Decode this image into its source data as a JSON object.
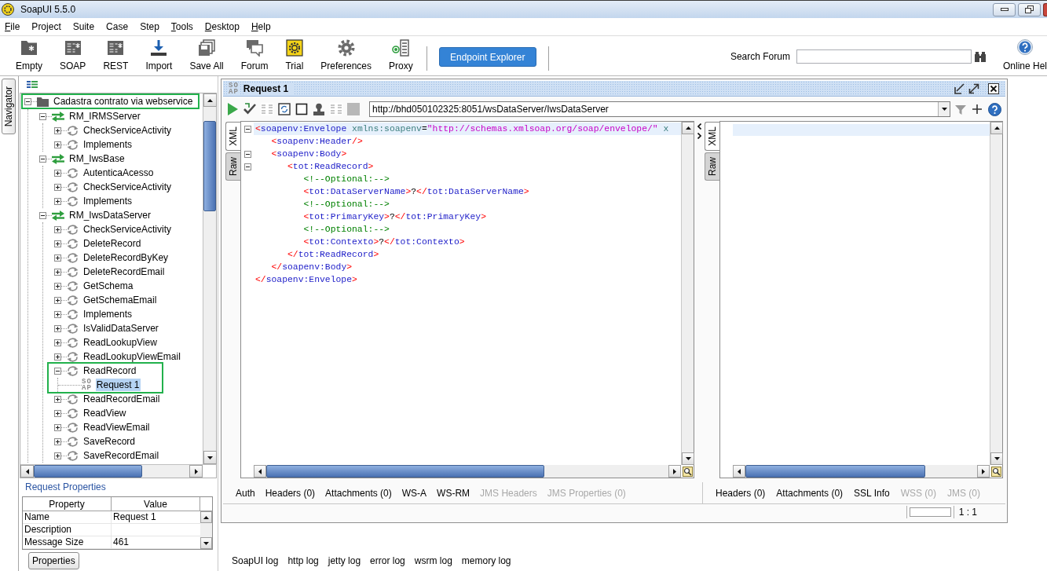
{
  "window": {
    "title": "SoapUI 5.5.0"
  },
  "menu": [
    {
      "label": "File",
      "mnemonic": true
    },
    {
      "label": "Project",
      "mnemonic": false
    },
    {
      "label": "Suite",
      "mnemonic": false
    },
    {
      "label": "Case",
      "mnemonic": false
    },
    {
      "label": "Step",
      "mnemonic": false
    },
    {
      "label": "Tools",
      "mnemonic": true
    },
    {
      "label": "Desktop",
      "mnemonic": true
    },
    {
      "label": "Help",
      "mnemonic": true
    }
  ],
  "toolbar": {
    "buttons": [
      {
        "label": "Empty"
      },
      {
        "label": "SOAP"
      },
      {
        "label": "REST"
      },
      {
        "label": "Import"
      },
      {
        "label": "Save All"
      },
      {
        "label": "Forum"
      },
      {
        "label": "Trial"
      },
      {
        "label": "Preferences"
      },
      {
        "label": "Proxy"
      }
    ],
    "endpoint_explorer": "Endpoint Explorer",
    "search_label": "Search Forum",
    "help_label": "Online Hel"
  },
  "navigator": {
    "tab": "Navigator",
    "tree": [
      {
        "label": "Cadastra contrato via webservice",
        "kind": "project",
        "expanded": true,
        "selected": false,
        "framed": true,
        "frame_children": false,
        "children": [
          {
            "label": "RM_IRMSServer",
            "kind": "interface",
            "expanded": true,
            "selected": false,
            "children": [
              {
                "label": "CheckServiceActivity",
                "kind": "operation",
                "expanded": false,
                "selected": false
              },
              {
                "label": "Implements",
                "kind": "operation",
                "expanded": false,
                "selected": false
              }
            ]
          },
          {
            "label": "RM_IwsBase",
            "kind": "interface",
            "expanded": true,
            "selected": false,
            "children": [
              {
                "label": "AutenticaAcesso",
                "kind": "operation",
                "expanded": false,
                "selected": false
              },
              {
                "label": "CheckServiceActivity",
                "kind": "operation",
                "expanded": false,
                "selected": false
              },
              {
                "label": "Implements",
                "kind": "operation",
                "expanded": false,
                "selected": false
              }
            ]
          },
          {
            "label": "RM_IwsDataServer",
            "kind": "interface",
            "expanded": true,
            "selected": false,
            "children": [
              {
                "label": "CheckServiceActivity",
                "kind": "operation",
                "expanded": false,
                "selected": false
              },
              {
                "label": "DeleteRecord",
                "kind": "operation",
                "expanded": false,
                "selected": false
              },
              {
                "label": "DeleteRecordByKey",
                "kind": "operation",
                "expanded": false,
                "selected": false
              },
              {
                "label": "DeleteRecordEmail",
                "kind": "operation",
                "expanded": false,
                "selected": false
              },
              {
                "label": "GetSchema",
                "kind": "operation",
                "expanded": false,
                "selected": false
              },
              {
                "label": "GetSchemaEmail",
                "kind": "operation",
                "expanded": false,
                "selected": false
              },
              {
                "label": "Implements",
                "kind": "operation",
                "expanded": false,
                "selected": false
              },
              {
                "label": "IsValidDataServer",
                "kind": "operation",
                "expanded": false,
                "selected": false
              },
              {
                "label": "ReadLookupView",
                "kind": "operation",
                "expanded": false,
                "selected": false
              },
              {
                "label": "ReadLookupViewEmail",
                "kind": "operation",
                "expanded": false,
                "selected": false
              },
              {
                "label": "ReadRecord",
                "kind": "operation",
                "expanded": true,
                "selected": false,
                "framed": true,
                "frame_children": true,
                "children": [
                  {
                    "label": "Request 1",
                    "kind": "request",
                    "badge": [
                      "SO",
                      "AP"
                    ],
                    "selected": true
                  }
                ]
              },
              {
                "label": "ReadRecordEmail",
                "kind": "operation",
                "expanded": false,
                "selected": false
              },
              {
                "label": "ReadView",
                "kind": "operation",
                "expanded": false,
                "selected": false
              },
              {
                "label": "ReadViewEmail",
                "kind": "operation",
                "expanded": false,
                "selected": false
              },
              {
                "label": "SaveRecord",
                "kind": "operation",
                "expanded": false,
                "selected": false
              },
              {
                "label": "SaveRecordEmail",
                "kind": "operation",
                "expanded": false,
                "selected": false
              }
            ]
          }
        ]
      }
    ],
    "properties": {
      "title": "Request Properties",
      "columns": [
        "Property",
        "Value"
      ],
      "rows": [
        {
          "property": "Name",
          "value": "Request 1"
        },
        {
          "property": "Description"
        },
        {
          "property": "Message Size",
          "value": "461"
        }
      ]
    },
    "button": "Properties"
  },
  "editor": {
    "title": "Request 1",
    "badge": [
      "SO",
      "AP"
    ],
    "endpoint": "http://bhd050102325:8051/wsDataServer/IwsDataServer",
    "request": {
      "tabs": [
        {
          "label": "XML",
          "selected": true
        },
        {
          "label": "Raw",
          "selected": false
        }
      ],
      "lines": [
        {
          "fold": true,
          "current": true,
          "tokens": [
            {
              "kind": "bracket",
              "text": "<"
            },
            {
              "kind": "tag",
              "text": "soapenv:Envelope"
            },
            {
              "kind": "attribute",
              "text": " xmlns:soapenv"
            },
            {
              "kind": "equals",
              "text": "="
            },
            {
              "kind": "string",
              "text": "\"http://schemas.xmlsoap.org/soap/envelope/\""
            },
            {
              "kind": "attribute",
              "text": " x"
            }
          ]
        },
        {
          "fold": false,
          "current": false,
          "tokens": [
            {
              "kind": "bracket",
              "text": "   <"
            },
            {
              "kind": "tag",
              "text": "soapenv:Header"
            },
            {
              "kind": "bracket",
              "text": "/>"
            }
          ]
        },
        {
          "fold": true,
          "current": false,
          "tokens": [
            {
              "kind": "bracket",
              "text": "   <"
            },
            {
              "kind": "tag",
              "text": "soapenv:Body"
            },
            {
              "kind": "bracket",
              "text": ">"
            }
          ]
        },
        {
          "fold": true,
          "current": false,
          "tokens": [
            {
              "kind": "bracket",
              "text": "      <"
            },
            {
              "kind": "tag",
              "text": "tot:ReadRecord"
            },
            {
              "kind": "bracket",
              "text": ">"
            }
          ]
        },
        {
          "fold": false,
          "current": false,
          "tokens": [
            {
              "kind": "comment",
              "text": "         <!--Optional:-->"
            }
          ]
        },
        {
          "fold": false,
          "current": false,
          "tokens": [
            {
              "kind": "bracket",
              "text": "         <"
            },
            {
              "kind": "tag",
              "text": "tot:DataServerName"
            },
            {
              "kind": "bracket",
              "text": ">"
            },
            {
              "kind": "text",
              "text": "?"
            },
            {
              "kind": "bracket",
              "text": "</"
            },
            {
              "kind": "tag",
              "text": "tot:DataServerName"
            },
            {
              "kind": "bracket",
              "text": ">"
            }
          ]
        },
        {
          "fold": false,
          "current": false,
          "tokens": [
            {
              "kind": "comment",
              "text": "         <!--Optional:-->"
            }
          ]
        },
        {
          "fold": false,
          "current": false,
          "tokens": [
            {
              "kind": "bracket",
              "text": "         <"
            },
            {
              "kind": "tag",
              "text": "tot:PrimaryKey"
            },
            {
              "kind": "bracket",
              "text": ">"
            },
            {
              "kind": "text",
              "text": "?"
            },
            {
              "kind": "bracket",
              "text": "</"
            },
            {
              "kind": "tag",
              "text": "tot:PrimaryKey"
            },
            {
              "kind": "bracket",
              "text": ">"
            }
          ]
        },
        {
          "fold": false,
          "current": false,
          "tokens": [
            {
              "kind": "comment",
              "text": "         <!--Optional:-->"
            }
          ]
        },
        {
          "fold": false,
          "current": false,
          "tokens": [
            {
              "kind": "bracket",
              "text": "         <"
            },
            {
              "kind": "tag",
              "text": "tot:Contexto"
            },
            {
              "kind": "bracket",
              "text": ">"
            },
            {
              "kind": "text",
              "text": "?"
            },
            {
              "kind": "bracket",
              "text": "</"
            },
            {
              "kind": "tag",
              "text": "tot:Contexto"
            },
            {
              "kind": "bracket",
              "text": ">"
            }
          ]
        },
        {
          "fold": false,
          "current": false,
          "tokens": [
            {
              "kind": "bracket",
              "text": "      </"
            },
            {
              "kind": "tag",
              "text": "tot:ReadRecord"
            },
            {
              "kind": "bracket",
              "text": ">"
            }
          ]
        },
        {
          "fold": false,
          "current": false,
          "tokens": [
            {
              "kind": "bracket",
              "text": "   </"
            },
            {
              "kind": "tag",
              "text": "soapenv:Body"
            },
            {
              "kind": "bracket",
              "text": ">"
            }
          ]
        },
        {
          "fold": false,
          "current": false,
          "tokens": [
            {
              "kind": "bracket",
              "text": "</"
            },
            {
              "kind": "tag",
              "text": "soapenv:Envelope"
            },
            {
              "kind": "bracket",
              "text": ">"
            }
          ]
        }
      ]
    },
    "response": {
      "tabs": [
        {
          "label": "XML",
          "selected": true
        },
        {
          "label": "Raw",
          "selected": false
        }
      ],
      "current_line": true
    },
    "request_tabs": [
      {
        "label": "Auth",
        "disabled": false
      },
      {
        "label": "Headers (0)",
        "disabled": false
      },
      {
        "label": "Attachments (0)",
        "disabled": false
      },
      {
        "label": "WS-A",
        "disabled": false
      },
      {
        "label": "WS-RM",
        "disabled": false
      },
      {
        "label": "JMS Headers",
        "disabled": true
      },
      {
        "label": "JMS Properties (0)",
        "disabled": true
      }
    ],
    "response_tabs": [
      {
        "label": "Headers (0)",
        "disabled": false
      },
      {
        "label": "Attachments (0)",
        "disabled": false
      },
      {
        "label": "SSL Info",
        "disabled": false
      },
      {
        "label": "WSS (0)",
        "disabled": true
      },
      {
        "label": "JMS (0)",
        "disabled": true
      }
    ],
    "position": "1 : 1"
  },
  "logs": [
    "SoapUI log",
    "http log",
    "jetty log",
    "error log",
    "wsrm log",
    "memory log"
  ]
}
